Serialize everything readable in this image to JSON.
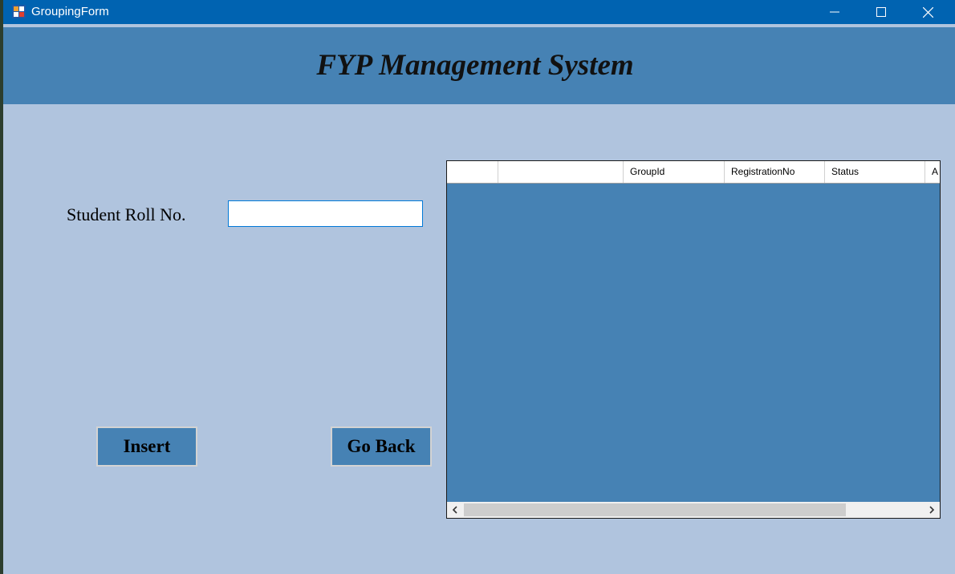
{
  "window": {
    "title": "GroupingForm"
  },
  "header": {
    "title": "FYP Management System"
  },
  "form": {
    "roll_label": "Student Roll No.",
    "roll_value": ""
  },
  "buttons": {
    "insert": "Insert",
    "go_back": "Go Back"
  },
  "grid": {
    "columns": [
      "",
      "",
      "GroupId",
      "RegistrationNo",
      "Status",
      "A"
    ],
    "rows": []
  },
  "colors": {
    "titlebar": "#0063b1",
    "header_band": "#4682b4",
    "form_background": "#b0c4de",
    "button_background": "#4682b4",
    "grid_background": "#4682b4"
  },
  "icons": {
    "app": "winforms-app-icon",
    "minimize": "minimize-icon",
    "maximize": "maximize-icon",
    "close": "close-icon",
    "scroll_left": "chevron-left-icon",
    "scroll_right": "chevron-right-icon"
  }
}
